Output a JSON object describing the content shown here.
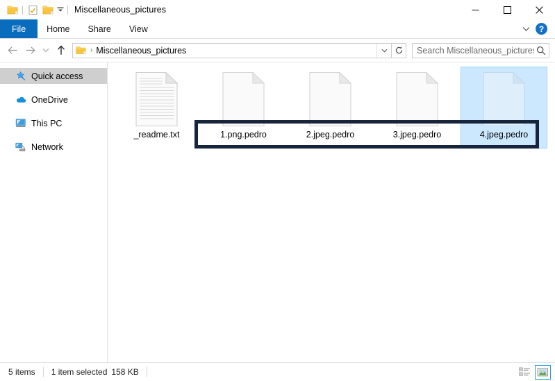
{
  "window": {
    "title": "Miscellaneous_pictures",
    "quick_access_toolbar": [
      {
        "name": "folder-icon",
        "label": "Folder"
      },
      {
        "name": "properties-icon",
        "label": "Properties"
      },
      {
        "name": "new-folder-icon",
        "label": "New folder"
      },
      {
        "name": "customize-caret-icon",
        "label": "Customize Quick Access Toolbar"
      }
    ],
    "controls": {
      "minimize": "—",
      "maximize": "☐",
      "close": "✕"
    }
  },
  "ribbon": {
    "tabs": [
      {
        "label": "File",
        "active": true
      },
      {
        "label": "Home",
        "active": false
      },
      {
        "label": "Share",
        "active": false
      },
      {
        "label": "View",
        "active": false
      }
    ],
    "expand_label": "∨",
    "help_label": "?"
  },
  "address_bar": {
    "back_label": "←",
    "forward_label": "→",
    "recent_label": "∨",
    "up_label": "↑",
    "crumb_separator": "›",
    "path": "Miscellaneous_pictures",
    "dropdown_label": "∨",
    "refresh_label": "↻"
  },
  "search": {
    "placeholder": "Search Miscellaneous_pictures",
    "value": ""
  },
  "sidebar": {
    "items": [
      {
        "label": "Quick access",
        "icon": "star-pin-icon",
        "selected": true
      },
      {
        "label": "OneDrive",
        "icon": "cloud-icon",
        "selected": false
      },
      {
        "label": "This PC",
        "icon": "monitor-icon",
        "selected": false
      },
      {
        "label": "Network",
        "icon": "network-icon",
        "selected": false
      }
    ]
  },
  "files": [
    {
      "name": "_readme.txt",
      "icon": "text-document-icon",
      "selected": false
    },
    {
      "name": "1.png.pedro",
      "icon": "blank-document-icon",
      "selected": false
    },
    {
      "name": "2.jpeg.pedro",
      "icon": "blank-document-icon",
      "selected": false
    },
    {
      "name": "3.jpeg.pedro",
      "icon": "blank-document-icon",
      "selected": false
    },
    {
      "name": "4.jpeg.pedro",
      "icon": "blank-document-icon",
      "selected": true
    }
  ],
  "annotation": {
    "color": "#16243c",
    "covers": "encrypted .pedro filenames"
  },
  "status_bar": {
    "item_count": "5 items",
    "selection": "1 item selected",
    "size": "158 KB",
    "views": [
      {
        "name": "details-view-button",
        "active": false
      },
      {
        "name": "large-icons-view-button",
        "active": true
      }
    ]
  },
  "colors": {
    "accent_blue": "#0a6cbc",
    "selection_blue": "#cce8ff",
    "annotation_navy": "#16243c",
    "folder_yellow": "#fcc43c"
  }
}
